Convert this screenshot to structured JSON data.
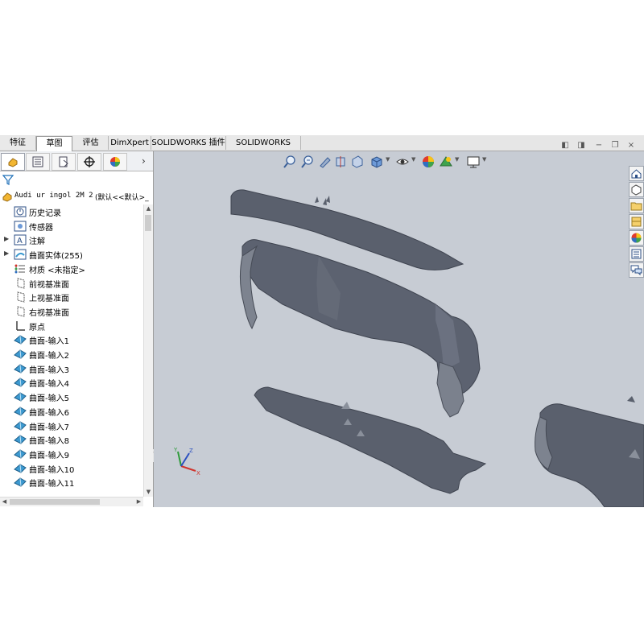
{
  "tabs": [
    {
      "label": "特征",
      "active": false
    },
    {
      "label": "草图",
      "active": true
    },
    {
      "label": "评估",
      "active": false
    },
    {
      "label": "DimXpert",
      "active": false
    },
    {
      "label": "SOLIDWORKS 插件",
      "active": false
    },
    {
      "label": "SOLIDWORKS MBD",
      "active": false
    }
  ],
  "panel_tabs": [
    "feature-manager-icon",
    "property-manager-icon",
    "configuration-manager-icon",
    "dimxpert-manager-icon",
    "display-manager-icon"
  ],
  "root": {
    "label": "Audi ur ingol 2M 2",
    "config": "(默认<<默认>_"
  },
  "tree": [
    {
      "label": "历史记录",
      "icon": "history-icon",
      "expandable": false
    },
    {
      "label": "传感器",
      "icon": "sensor-icon",
      "expandable": false
    },
    {
      "label": "注解",
      "icon": "annotation-icon",
      "expandable": true
    },
    {
      "label": "曲面实体(255)",
      "icon": "surface-bodies-icon",
      "expandable": true
    },
    {
      "label": "材质 <未指定>",
      "icon": "material-icon",
      "expandable": false
    },
    {
      "label": "前视基准面",
      "icon": "plane-icon",
      "expandable": false
    },
    {
      "label": "上视基准面",
      "icon": "plane-icon",
      "expandable": false
    },
    {
      "label": "右视基准面",
      "icon": "plane-icon",
      "expandable": false
    },
    {
      "label": "原点",
      "icon": "origin-icon",
      "expandable": false
    },
    {
      "label": "曲面-输入1",
      "icon": "surface-icon",
      "expandable": false
    },
    {
      "label": "曲面-输入2",
      "icon": "surface-icon",
      "expandable": false
    },
    {
      "label": "曲面-输入3",
      "icon": "surface-icon",
      "expandable": false
    },
    {
      "label": "曲面-输入4",
      "icon": "surface-icon",
      "expandable": false
    },
    {
      "label": "曲面-输入5",
      "icon": "surface-icon",
      "expandable": false
    },
    {
      "label": "曲面-输入6",
      "icon": "surface-icon",
      "expandable": false
    },
    {
      "label": "曲面-输入7",
      "icon": "surface-icon",
      "expandable": false
    },
    {
      "label": "曲面-输入8",
      "icon": "surface-icon",
      "expandable": false
    },
    {
      "label": "曲面-输入9",
      "icon": "surface-icon",
      "expandable": false
    },
    {
      "label": "曲面-输入10",
      "icon": "surface-icon",
      "expandable": false
    },
    {
      "label": "曲面-输入11",
      "icon": "surface-icon",
      "expandable": false
    }
  ],
  "heads_up_toolbar": [
    "zoom-to-fit-icon",
    "zoom-to-area-icon",
    "previous-view-icon",
    "section-view-icon",
    "dynamic-annotation-icon",
    "view-orientation-icon",
    "display-style-icon",
    "hide-show-items-icon",
    "edit-appearance-icon",
    "apply-scene-icon",
    "view-settings-icon"
  ],
  "task_pane": [
    "home-icon",
    "3d-parts-icon",
    "file-explorer-icon",
    "view-palette-icon",
    "appearances-icon",
    "custom-properties-icon",
    "forum-icon"
  ],
  "triad_axes": [
    "X",
    "Y",
    "Z"
  ],
  "colors": {
    "viewport_bg": "#c7ccd4",
    "model_surface": "#5c6270",
    "model_edge": "#3e434e",
    "surface_icon": "#3d9ad1"
  }
}
